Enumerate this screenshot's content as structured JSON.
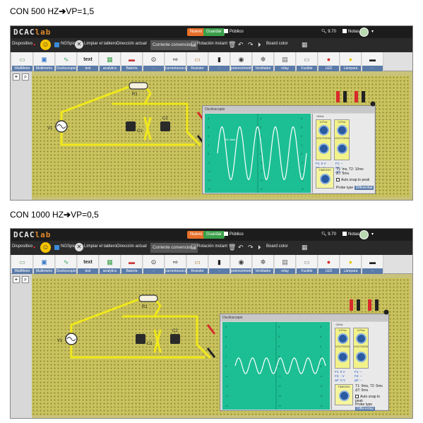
{
  "captions": [
    {
      "prefix": "CON 500 HZ",
      "arrow": "➔",
      "suffix": "VP=1,5"
    },
    {
      "prefix": "CON 1000 HZ",
      "arrow": "➔",
      "suffix": "VP=0,5"
    }
  ],
  "app": {
    "logo_main": "DCAC",
    "logo_accent": "lab",
    "nuevo": "Nuevo",
    "guardar": "Guardar",
    "publico": "Público",
    "zoom": "9.70",
    "notas": "Notas",
    "caret": "▾"
  },
  "toolbar": {
    "dispositivo": "Dispositivo",
    "ngspice": "NGSpice",
    "limpiar": "Limpiar el tablero",
    "direccion": "Dirección actual",
    "corriente": "Corriente convencional",
    "rotacion": "Rotación instant",
    "board_color": "Board color"
  },
  "palette": [
    {
      "label": "WallMeter",
      "icon": "meter-icon",
      "glyph": "▭",
      "color": "#7a9a7a"
    },
    {
      "label": "Multimetro",
      "icon": "multimeter-icon",
      "glyph": "▣",
      "color": "#3a7ac8"
    },
    {
      "label": "Osciloscopio",
      "icon": "oscilloscope-icon",
      "glyph": "∿",
      "color": "#2a9a4a"
    },
    {
      "label": "text",
      "icon": "text-icon",
      "glyph": "text",
      "color": "#222222"
    },
    {
      "label": "analytics",
      "icon": "analytics-icon",
      "glyph": "▦",
      "color": "#3aa04a"
    },
    {
      "label": "Batería",
      "icon": "battery-icon",
      "glyph": "▬",
      "color": "#c83a3a"
    },
    {
      "label": "∙∙∙",
      "icon": "ac-source-icon",
      "glyph": "⊙",
      "color": "#222222"
    },
    {
      "label": "currentsource",
      "icon": "current-source-icon",
      "glyph": "⇨",
      "color": "#222222"
    },
    {
      "label": "Resistor",
      "icon": "resistor-icon",
      "glyph": "▭",
      "color": "#b8864a"
    },
    {
      "label": "∙∙∙",
      "icon": "capacitor-icon",
      "glyph": "▮",
      "color": "#222222"
    },
    {
      "label": "potenciómetro",
      "icon": "potentiometer-icon",
      "glyph": "◉",
      "color": "#3a3a3a"
    },
    {
      "label": "Ventilador",
      "icon": "fan-icon",
      "glyph": "✲",
      "color": "#3a3a3a"
    },
    {
      "label": "relay",
      "icon": "relay-icon",
      "glyph": "▤",
      "color": "#666666"
    },
    {
      "label": "Fusible",
      "icon": "fuse-icon",
      "glyph": "▭",
      "color": "#888888"
    },
    {
      "label": "LED",
      "icon": "led-icon",
      "glyph": "●",
      "color": "#d82a2a"
    },
    {
      "label": "Lámpara",
      "icon": "lamp-icon",
      "glyph": "●",
      "color": "#e8c81a"
    },
    {
      "label": "∙∙∙",
      "icon": "switch-icon",
      "glyph": "▬",
      "color": "#222222"
    }
  ],
  "circuit": {
    "v1": "V1",
    "r1": "R1",
    "c1": "C1",
    "c2": "C2"
  },
  "scope": {
    "title": "Osciloscopio",
    "trace_label": "A/1 cline",
    "ch1": "V-Pos",
    "ch2": "V-Pos",
    "volt_label": "VOLTS/DIV",
    "timebase": "TIME/DIV",
    "autosnap": "Auto snap to peak",
    "probe_type": "Probe type",
    "differential": "Differential",
    "yticks": [
      "4",
      "3",
      "2",
      "1",
      "0",
      "-1",
      "-2",
      "-3",
      "-4"
    ],
    "shot1": {
      "freq": "~50Hz",
      "readout1": "F1: 0 V\nF2: - V\nΔF: 0 V",
      "readout2": "F1: --\nF2: --\nΔF: --",
      "tinfo": "T1: ms, T2: 10ms\nΔT: 5ms"
    },
    "shot2": {
      "freq": "~50Hz",
      "readout1": "F1: 0 V\nF2: - V\nΔF: 0 V",
      "readout2": "F1: --\nF2: --\nΔF: --",
      "tinfo": "T1: 0ms, T2: 5ms\nΔT: 5ms"
    }
  },
  "colors": {
    "board": "#c9c25e",
    "screen": "#1cbf94",
    "wire": "#f0e81a",
    "orange": "#e8702a",
    "green": "#3aa04a"
  }
}
